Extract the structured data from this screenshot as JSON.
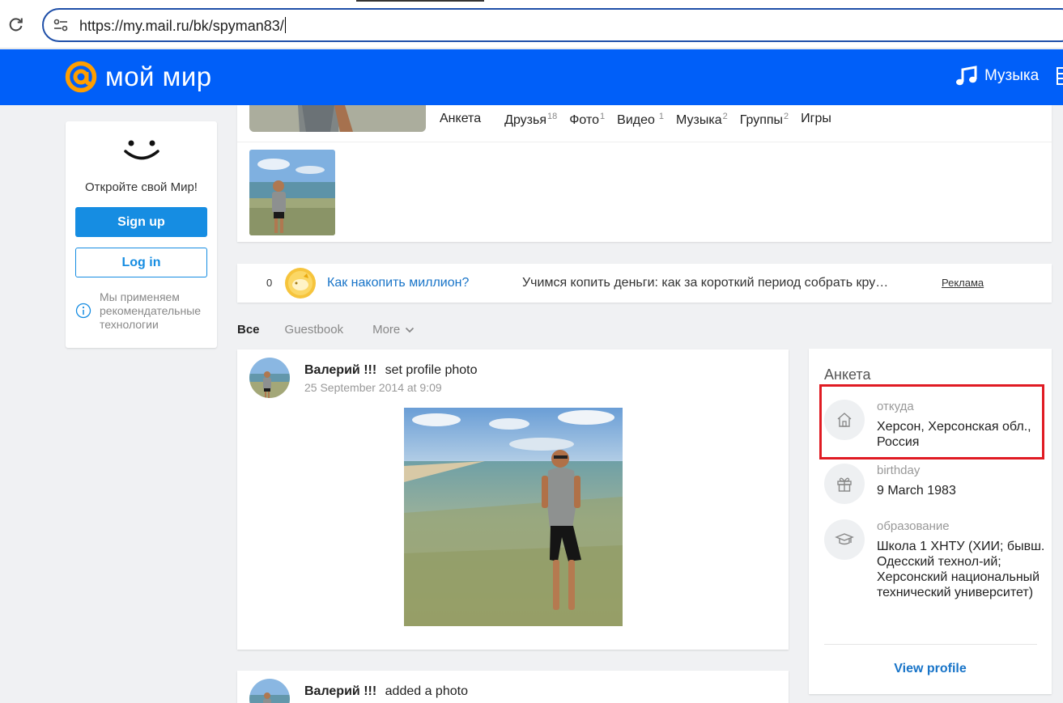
{
  "browser": {
    "url": "https://my.mail.ru/bk/spyman83/"
  },
  "header": {
    "logo_text": "мой мир",
    "music_label": "Музыка"
  },
  "left_card": {
    "open_world": "Откройте свой Мир!",
    "signup": "Sign up",
    "login": "Log in",
    "rec_tech": "Мы применяем рекомендательные технологии"
  },
  "profile": {
    "tabs": [
      {
        "label": "Анкета",
        "count": ""
      },
      {
        "label": "Друзья",
        "count": "18"
      },
      {
        "label": "Фото",
        "count": "1"
      },
      {
        "label": "Видео",
        "count": "1"
      },
      {
        "label": "Музыка",
        "count": "2"
      },
      {
        "label": "Группы",
        "count": "2"
      },
      {
        "label": "Игры",
        "count": ""
      }
    ]
  },
  "ad": {
    "count": "0",
    "title": "Как накопить миллион?",
    "description": "Учимся копить деньги: как за короткий период собрать кру…",
    "label": "Реклама"
  },
  "feed_filters": {
    "all": "Все",
    "guestbook": "Guestbook",
    "more": "More"
  },
  "posts": [
    {
      "author": "Валерий !!!",
      "action": "set profile photo",
      "date": "25 September 2014 at 9:09"
    },
    {
      "author": "Валерий !!!",
      "action": "added a photo"
    }
  ],
  "anketa": {
    "title": "Анкета",
    "rows": [
      {
        "icon": "home-icon",
        "label": "откуда",
        "value": "Херсон, Херсонская обл., Россия"
      },
      {
        "icon": "gift-icon",
        "label": "birthday",
        "value": "9 March 1983"
      },
      {
        "icon": "graduation-cap-icon",
        "label": "образование",
        "value": "Школа 1 ХНТУ (ХИИ; бывш. Одесский технол-ий; Херсонский национальный технический университет)"
      }
    ],
    "view_profile": "View profile"
  },
  "colors": {
    "brand_blue": "#005ff9",
    "button_blue": "#168de2",
    "link_blue": "#1874c8",
    "logo_orange": "#ff9e00",
    "highlight_red": "#e01b23"
  }
}
